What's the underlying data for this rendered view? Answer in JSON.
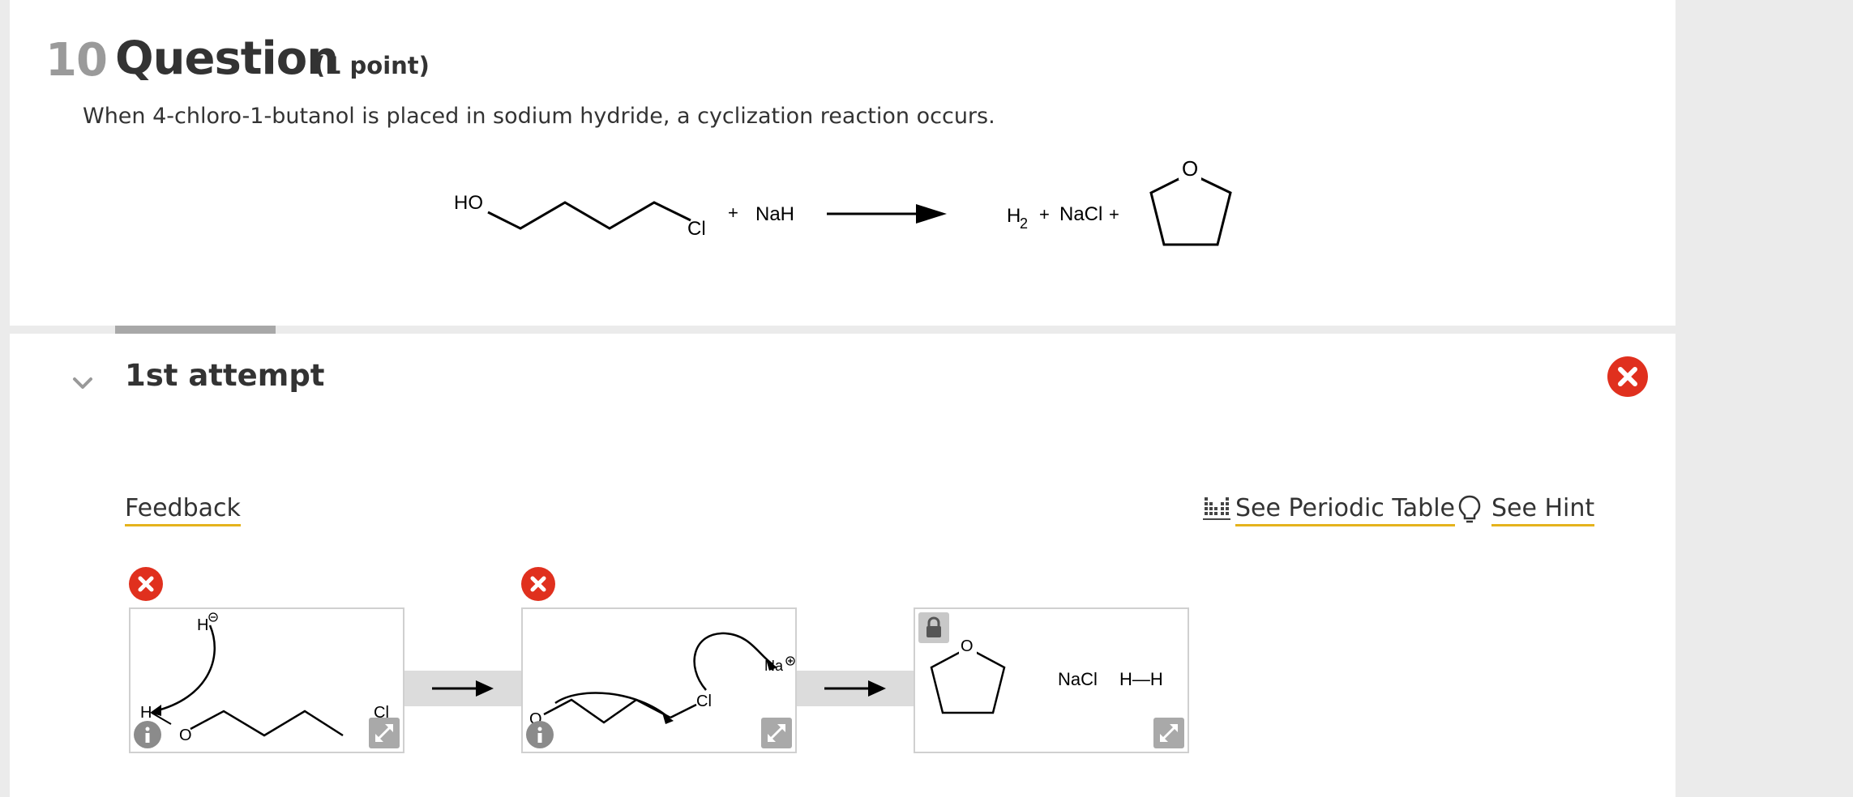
{
  "question": {
    "number": "10",
    "title": "Question",
    "points": "(1 point)",
    "text": "When 4-chloro-1-butanol is placed in sodium hydride, a cyclization reaction occurs."
  },
  "reaction": {
    "reactant_left_label": "HO",
    "reactant_right_label": "Cl",
    "plus1": "+",
    "reagent": "NaH",
    "product_h2": "H",
    "product_h2_sub": "2",
    "plus2": "+",
    "product_nacl": "NaCl",
    "plus3": "+",
    "ring_atom": "O"
  },
  "attempt": {
    "title": "1st attempt",
    "links": {
      "feedback": "Feedback",
      "periodic": "See Periodic Table",
      "hint": "See Hint"
    },
    "steps": [
      {
        "labels": [
          "H",
          "H",
          "O",
          "Cl"
        ],
        "status": "incorrect"
      },
      {
        "labels": [
          "O",
          "Cl",
          "Na"
        ],
        "status": "incorrect"
      },
      {
        "labels": [
          "O"
        ],
        "nacl": "NaCl",
        "hh": "H—H",
        "status": "locked"
      }
    ]
  },
  "colors": {
    "error_red": "#e0301e",
    "link_underline": "#e5b31c",
    "number_gray": "#9a9a9a"
  },
  "icons": [
    "chevron-down-icon",
    "close-icon",
    "periodic-table-icon",
    "lightbulb-icon",
    "info-icon",
    "expand-icon",
    "lock-icon"
  ]
}
